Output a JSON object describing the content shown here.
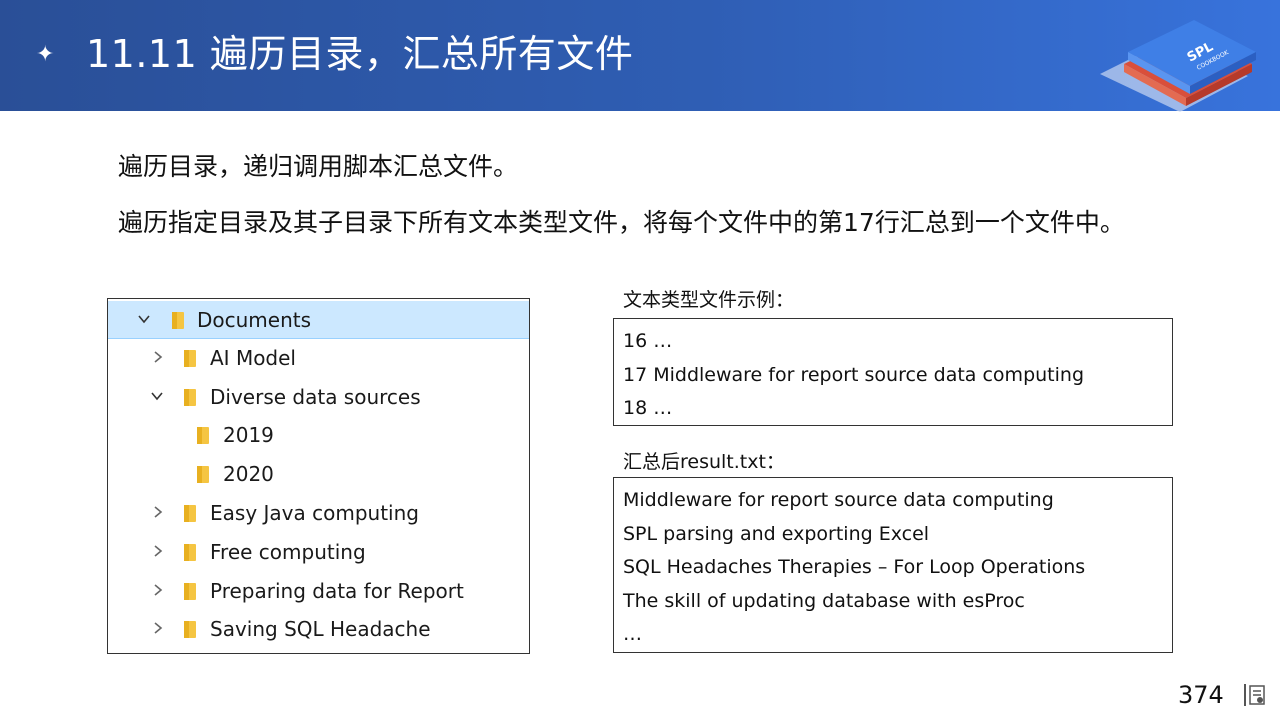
{
  "header": {
    "bullet": "✦",
    "title": "11.11 遍历目录，汇总所有文件",
    "logo_text": "SPL",
    "logo_subtext": "COOKBOOK"
  },
  "description": {
    "line1": "遍历目录，递归调用脚本汇总文件。",
    "line2": "遍历指定目录及其子目录下所有文本类型文件，将每个文件中的第17行汇总到一个文件中。"
  },
  "tree": {
    "items": [
      {
        "label": "Documents",
        "expanded": true,
        "level": 0,
        "selected": true
      },
      {
        "label": "AI Model",
        "expanded": false,
        "level": 1
      },
      {
        "label": "Diverse data sources",
        "expanded": true,
        "level": 1
      },
      {
        "label": "2019",
        "leaf": true,
        "level": 2
      },
      {
        "label": "2020",
        "leaf": true,
        "level": 2
      },
      {
        "label": "Easy Java computing",
        "expanded": false,
        "level": 1
      },
      {
        "label": "Free computing",
        "expanded": false,
        "level": 1
      },
      {
        "label": "Preparing data for Report",
        "expanded": false,
        "level": 1
      },
      {
        "label": "Saving SQL Headache",
        "expanded": false,
        "level": 1
      }
    ]
  },
  "example": {
    "caption": "文本类型文件示例：",
    "lines": [
      "16 …",
      "17 Middleware for report source data computing",
      "18 …"
    ]
  },
  "result": {
    "caption": "汇总后result.txt：",
    "lines": [
      "Middleware for report source data computing",
      "SPL parsing and exporting Excel",
      "SQL Headaches Therapies – For Loop Operations",
      "The skill of updating database with esProc",
      "…"
    ]
  },
  "footer": {
    "page_number": "374"
  },
  "colors": {
    "header_start": "#2a4f97",
    "header_end": "#3873dc",
    "selection": "#cce8ff",
    "folder": "#f5c542"
  }
}
